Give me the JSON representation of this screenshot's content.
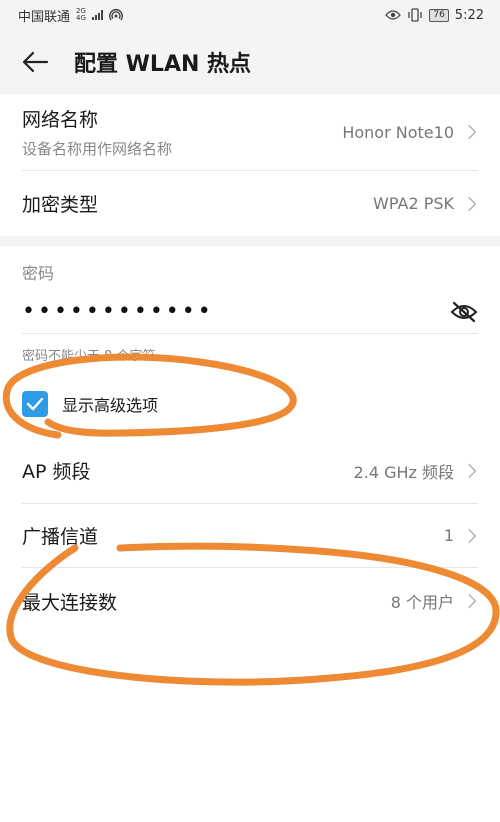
{
  "status_bar": {
    "carrier": "中国联通",
    "net_top": "2G",
    "net_bottom": "4G",
    "battery": "76",
    "time": "5:22"
  },
  "header": {
    "title": "配置 WLAN 热点"
  },
  "network_name": {
    "label": "网络名称",
    "sub": "设备名称用作网络名称",
    "value": "Honor Note10"
  },
  "encryption": {
    "label": "加密类型",
    "value": "WPA2 PSK"
  },
  "password": {
    "section_label": "密码",
    "value": "••••••••••••",
    "hint": "密码不能少于 8 个字符"
  },
  "advanced": {
    "label": "显示高级选项",
    "checked": true
  },
  "ap_band": {
    "label": "AP 频段",
    "value": "2.4 GHz 频段"
  },
  "channel": {
    "label": "广播信道",
    "value": "1"
  },
  "max_connections": {
    "label": "最大连接数",
    "value": "8 个用户"
  },
  "colors": {
    "accent": "#2e9be6",
    "annotation": "#ee8a34"
  }
}
